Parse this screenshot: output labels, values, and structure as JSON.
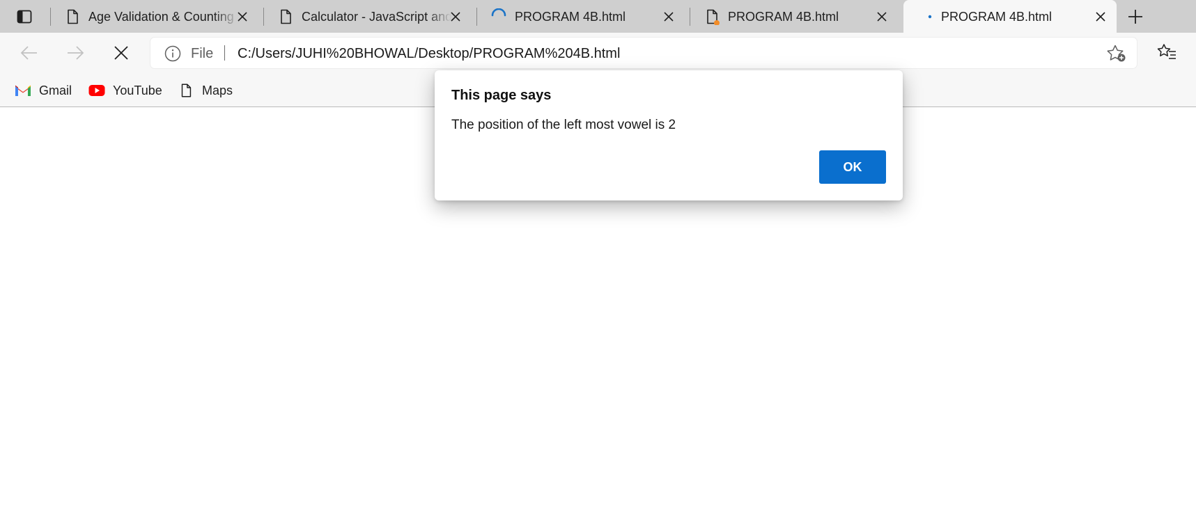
{
  "tabs": [
    {
      "title": "Age Validation & Counting",
      "icon": "page-icon",
      "active": false
    },
    {
      "title": "Calculator - JavaScript and",
      "icon": "page-icon",
      "active": false
    },
    {
      "title": "PROGRAM 4B.html",
      "icon": "loading-spinner-icon",
      "active": false
    },
    {
      "title": "PROGRAM 4B.html",
      "icon": "page-icon",
      "active": false
    },
    {
      "title": "PROGRAM 4B.html",
      "icon": "loading-dot-icon",
      "active": true
    }
  ],
  "address_bar": {
    "scheme": "File",
    "url": "C:/Users/JUHI%20BHOWAL/Desktop/PROGRAM%204B.html"
  },
  "bookmarks": [
    {
      "label": "Gmail",
      "icon": "gmail-icon"
    },
    {
      "label": "YouTube",
      "icon": "youtube-icon"
    },
    {
      "label": "Maps",
      "icon": "page-icon"
    }
  ],
  "dialog": {
    "title": "This page says",
    "message": "The position of the left most vowel is 2",
    "ok_label": "OK"
  },
  "colors": {
    "accent": "#0a6fce",
    "tabstrip_bg": "#cfcfcf",
    "toolbar_bg": "#f7f7f7",
    "notification_dot": "#f28c28",
    "spinner": "#1a73c7"
  }
}
